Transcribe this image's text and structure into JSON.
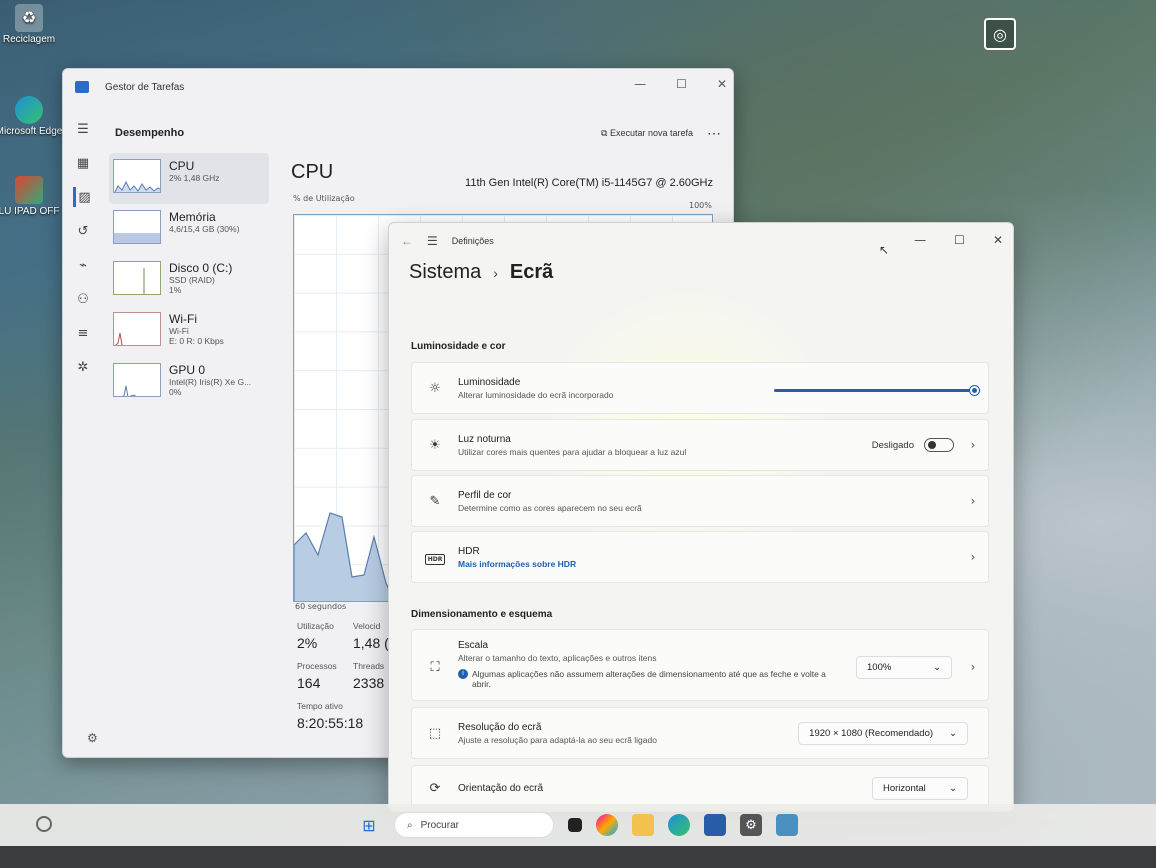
{
  "desktop": {
    "icons": [
      {
        "label": "Reciclagem"
      },
      {
        "label": "Microsoft Edge"
      },
      {
        "label": "LU IPAD OFF"
      }
    ]
  },
  "taskmgr": {
    "title": "Gestor de Tarefas",
    "section": "Desempenho",
    "run_task": "Executar nova tarefa",
    "items": [
      {
        "name": "CPU",
        "s1": "2% 1,48 GHz",
        "s2": ""
      },
      {
        "name": "Memória",
        "s1": "4,6/15,4 GB (30%)",
        "s2": ""
      },
      {
        "name": "Disco 0 (C:)",
        "s1": "SSD (RAID)",
        "s2": "1%"
      },
      {
        "name": "Wi-Fi",
        "s1": "Wi-Fi",
        "s2": "E: 0 R: 0 Kbps"
      },
      {
        "name": "GPU 0",
        "s1": "Intel(R) Iris(R) Xe G...",
        "s2": "0%"
      }
    ],
    "main_title": "CPU",
    "cpu_model": "11th Gen Intel(R) Core(TM) i5-1145G7 @ 2.60GHz",
    "graph_label": "% de Utilização",
    "graph_max": "100%",
    "graph_seconds": "60 segundos",
    "stats": {
      "util_label": "Utilização",
      "util_value": "2%",
      "speed_label": "Velocid",
      "speed_value": "1,48 (",
      "proc_label": "Processos",
      "proc_value": "164",
      "threads_label": "Threads",
      "threads_value": "2338",
      "uptime_label": "Tempo ativo",
      "uptime_value": "8:20:55:18"
    }
  },
  "settings": {
    "title": "Definições",
    "crumb_parent": "Sistema",
    "crumb_current": "Ecrã",
    "section1": "Luminosidade e cor",
    "brightness": {
      "title": "Luminosidade",
      "desc": "Alterar luminosidade do ecrã incorporado",
      "level": 1.0
    },
    "night": {
      "title": "Luz noturna",
      "desc": "Utilizar cores mais quentes para ajudar a bloquear a luz azul",
      "state": "Desligado"
    },
    "profile": {
      "title": "Perfil de cor",
      "desc": "Determine como as cores aparecem no seu ecrã"
    },
    "hdr": {
      "title": "HDR",
      "link": "Mais informações sobre HDR"
    },
    "section2": "Dimensionamento e esquema",
    "scale": {
      "title": "Escala",
      "desc": "Alterar o tamanho do texto, aplicações e outros itens",
      "value": "100%",
      "note": "Algumas aplicações não assumem alterações de dimensionamento até que as feche e volte a abrir."
    },
    "resolution": {
      "title": "Resolução do ecrã",
      "desc": "Ajuste a resolução para adaptá-la ao seu ecrã ligado",
      "value": "1920 × 1080 (Recomendado)"
    },
    "orientation": {
      "title": "Orientação do ecrã",
      "value": "Horizontal"
    }
  },
  "taskbar": {
    "search_placeholder": "Procurar"
  },
  "colors": {
    "accent": "#1f5fad",
    "graph_line": "#7da2c8"
  }
}
